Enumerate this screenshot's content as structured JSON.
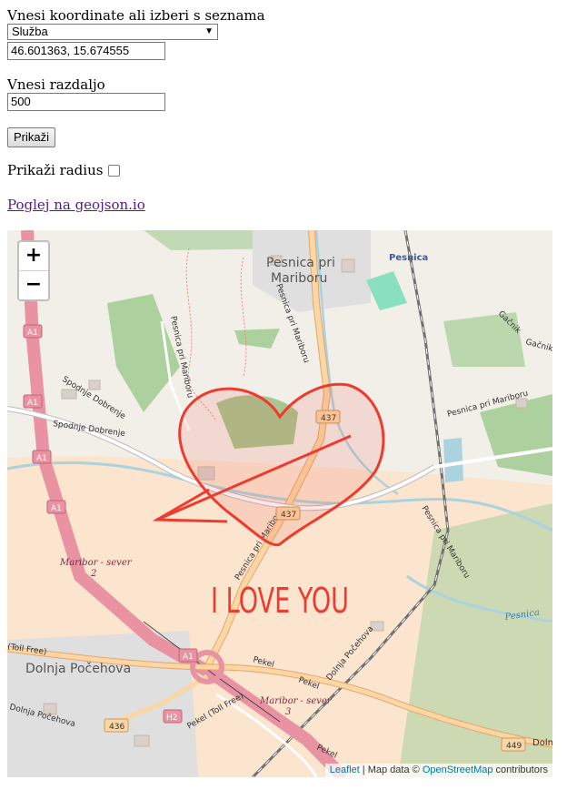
{
  "form": {
    "coord_label": "Vnesi koordinate ali izberi s seznama",
    "select_value": "Služba",
    "coord_value": "46.601363, 15.674555",
    "dist_label": "Vnesi razdaljo",
    "dist_value": "500",
    "show_button": "Prikaži",
    "radius_label": "Prikaži radius",
    "radius_checked": false,
    "geojson_link": "Poglej na geojson.io"
  },
  "map": {
    "zoom_in": "+",
    "zoom_out": "−",
    "labels": {
      "pesnica_pri_mariboru": "Pesnica pri",
      "pesnica_pri_mariboru_2": "Mariboru",
      "pesnica": "Pesnica",
      "dolnja_pocehova": "Dolnja Počehova",
      "maribor_sever": "Maribor - sever",
      "maribor_sever_2": "2",
      "maribor_sever_b": "Maribor - sever",
      "maribor_sever_b2": "3",
      "spodnje_dobrenje": "Spodnje Dobrenje",
      "gacnik": "Gačnik",
      "pekel": "Pekel",
      "pekel_toll": "Pekel (Toll Free)",
      "toll_free": "(Toll Free)",
      "pesnica_river": "Pesnica",
      "road_pesnica_pri_mariboru": "Pesnica pri Mariboru",
      "dolnja": "Doln",
      "dolnja_pocehova_road": "Dolnja Počehova"
    },
    "shields": {
      "a1": "A1",
      "r437": "437",
      "r436": "436",
      "r449": "449",
      "h2": "H2"
    },
    "overlay_text": "I LOVE YOU",
    "attribution": {
      "leaflet": "Leaflet",
      "sep": " | Map data © ",
      "osm": "OpenStreetMap",
      "contrib": " contributors"
    }
  },
  "colors": {
    "motorway": "#e892a2",
    "primary": "#fcd6a4",
    "water": "#aad3df",
    "forest": "#add19e",
    "industrial": "#fbe5cf",
    "overlay_red": "#ee3b30"
  }
}
